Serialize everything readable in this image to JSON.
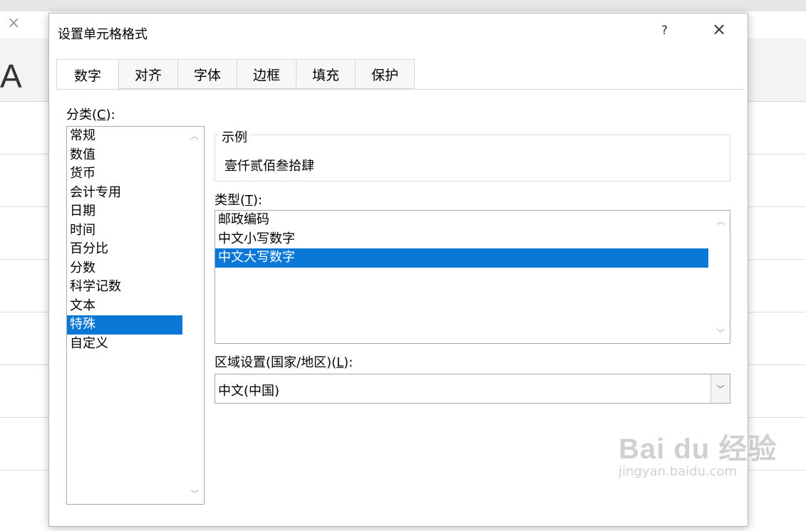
{
  "dialog": {
    "title": "设置单元格格式",
    "help_label": "?",
    "close_label": "×"
  },
  "background": {
    "close_glyph": "×",
    "column_label": "A"
  },
  "tabs": [
    {
      "label": "数字",
      "active": true
    },
    {
      "label": "对齐",
      "active": false
    },
    {
      "label": "字体",
      "active": false
    },
    {
      "label": "边框",
      "active": false
    },
    {
      "label": "填充",
      "active": false
    },
    {
      "label": "保护",
      "active": false
    }
  ],
  "category": {
    "label_prefix": "分类(",
    "label_key": "C",
    "label_suffix": "):",
    "items": [
      "常规",
      "数值",
      "货币",
      "会计专用",
      "日期",
      "时间",
      "百分比",
      "分数",
      "科学记数",
      "文本",
      "特殊",
      "自定义"
    ],
    "selected": "特殊"
  },
  "sample": {
    "legend": "示例",
    "value": "壹仟贰佰叁拾肆"
  },
  "type": {
    "label_prefix": "类型(",
    "label_key": "T",
    "label_suffix": "):",
    "items": [
      "邮政编码",
      "中文小写数字",
      "中文大写数字"
    ],
    "selected": "中文大写数字"
  },
  "locale": {
    "label_prefix": "区域设置(国家/地区)(",
    "label_key": "L",
    "label_suffix": "):",
    "value": "中文(中国)"
  },
  "watermark": {
    "logo": "Bai du 经验",
    "url": "jingyan.baidu.com"
  },
  "colors": {
    "selection": "#0b78d7",
    "selection_text": "#ffffff"
  }
}
